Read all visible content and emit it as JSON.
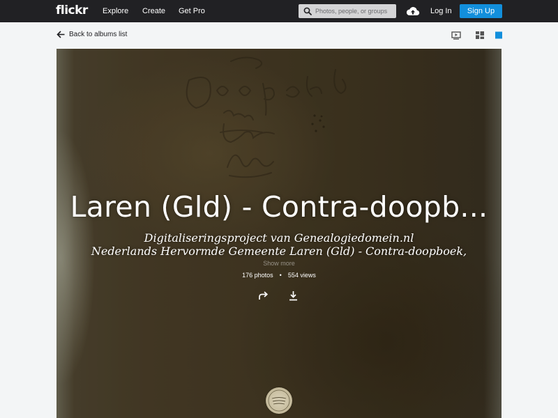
{
  "topbar": {
    "logo": "flickr",
    "nav": [
      "Explore",
      "Create",
      "Get Pro"
    ],
    "search_placeholder": "Photos, people, or groups",
    "login": "Log In",
    "signup": "Sign Up"
  },
  "subbar": {
    "back_label": "Back to albums list"
  },
  "album": {
    "title": "Laren (Gld) - Contra-doopb...",
    "description_line1": "Digitaliseringsproject van Genealogiedomein.nl",
    "description_line2": "Nederlands Hervormde Gemeente Laren (Gld) - Contra-doopboek,",
    "show_more": "Show more",
    "photos": "176 photos",
    "separator": "•",
    "views": "554 views"
  },
  "colors": {
    "topbar_bg": "#212124",
    "accent": "#128fdc",
    "page_bg": "#f3f5f6"
  }
}
